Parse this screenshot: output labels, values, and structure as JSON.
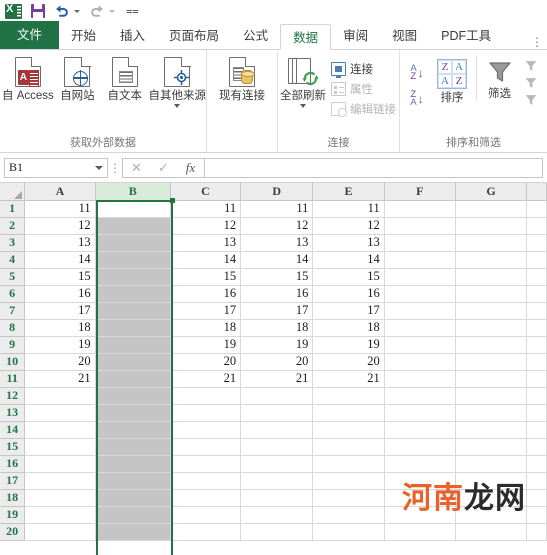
{
  "app": {
    "name": "Excel",
    "active_cell": "B1",
    "formula_value": ""
  },
  "quick_access": {
    "items": [
      {
        "name": "excel-logo",
        "label": "X"
      },
      {
        "name": "save",
        "label": "保存"
      },
      {
        "name": "undo",
        "label": "撤消"
      },
      {
        "name": "redo",
        "label": "恢复"
      },
      {
        "name": "customize",
        "label": "自定义快速访问工具栏"
      }
    ]
  },
  "tabs": {
    "file": "文件",
    "items": [
      {
        "label": "开始",
        "active": false
      },
      {
        "label": "插入",
        "active": false
      },
      {
        "label": "页面布局",
        "active": false
      },
      {
        "label": "公式",
        "active": false
      },
      {
        "label": "数据",
        "active": true
      },
      {
        "label": "审阅",
        "active": false
      },
      {
        "label": "视图",
        "active": false
      },
      {
        "label": "PDF工具",
        "active": false
      }
    ],
    "more": "⋮"
  },
  "ribbon": {
    "groups": [
      {
        "label": "获取外部数据",
        "buttons": [
          {
            "label": "自 Access",
            "icon": "access-doc-icon",
            "dropdown": false
          },
          {
            "label": "自网站",
            "icon": "web-doc-icon",
            "dropdown": false
          },
          {
            "label": "自文本",
            "icon": "text-doc-icon",
            "dropdown": false
          },
          {
            "label": "自其他来源",
            "icon": "other-sources-doc-icon",
            "dropdown": true
          }
        ]
      },
      {
        "label": "",
        "buttons": [
          {
            "label": "现有连接",
            "icon": "existing-connections-icon",
            "dropdown": false
          }
        ]
      },
      {
        "label": "连接",
        "buttons": [
          {
            "label": "全部刷新",
            "icon": "refresh-all-icon",
            "dropdown": true
          }
        ],
        "small_buttons": [
          {
            "label": "连接",
            "icon": "connections-icon",
            "disabled": false
          },
          {
            "label": "属性",
            "icon": "properties-icon",
            "disabled": true
          },
          {
            "label": "编辑链接",
            "icon": "edit-links-icon",
            "disabled": true
          }
        ]
      },
      {
        "label": "排序和筛选",
        "small_buttons": [
          {
            "label": "升序排序",
            "icon": "sort-az-icon",
            "disabled": false
          },
          {
            "label": "降序排序",
            "icon": "sort-za-icon",
            "disabled": false
          }
        ],
        "buttons": [
          {
            "label": "排序",
            "icon": "sort-icon",
            "dropdown": false
          },
          {
            "label": "筛选",
            "icon": "filter-funnel-icon",
            "dropdown": false
          }
        ]
      }
    ]
  },
  "formula_bar": {
    "name_box": "B1",
    "cancel": "✕",
    "confirm": "✓",
    "function": "fx",
    "value": ""
  },
  "sheet": {
    "columns": [
      "A",
      "B",
      "C",
      "D",
      "E",
      "F",
      "G"
    ],
    "selected_column": "B",
    "rows": [
      1,
      2,
      3,
      4,
      5,
      6,
      7,
      8,
      9,
      10,
      11,
      12,
      13,
      14,
      15,
      16,
      17,
      18,
      19,
      20
    ],
    "cells": {
      "A": [
        "11",
        "12",
        "13",
        "14",
        "15",
        "16",
        "17",
        "18",
        "19",
        "20",
        "21",
        "",
        "",
        "",
        "",
        "",
        "",
        "",
        "",
        ""
      ],
      "B": [
        "",
        "",
        "",
        "",
        "",
        "",
        "",
        "",
        "",
        "",
        "",
        "",
        "",
        "",
        "",
        "",
        "",
        "",
        "",
        ""
      ],
      "C": [
        "11",
        "12",
        "13",
        "14",
        "15",
        "16",
        "17",
        "18",
        "19",
        "20",
        "21",
        "",
        "",
        "",
        "",
        "",
        "",
        "",
        "",
        ""
      ],
      "D": [
        "11",
        "12",
        "13",
        "14",
        "15",
        "16",
        "17",
        "18",
        "19",
        "20",
        "21",
        "",
        "",
        "",
        "",
        "",
        "",
        "",
        "",
        ""
      ],
      "E": [
        "11",
        "12",
        "13",
        "14",
        "15",
        "16",
        "17",
        "18",
        "19",
        "20",
        "21",
        "",
        "",
        "",
        "",
        "",
        "",
        "",
        "",
        ""
      ],
      "F": [
        "",
        "",
        "",
        "",
        "",
        "",
        "",
        "",
        "",
        "",
        "",
        "",
        "",
        "",
        "",
        "",
        "",
        "",
        "",
        ""
      ],
      "G": [
        "",
        "",
        "",
        "",
        "",
        "",
        "",
        "",
        "",
        "",
        "",
        "",
        "",
        "",
        "",
        "",
        "",
        "",
        "",
        ""
      ]
    }
  },
  "watermark": {
    "part1": "河南",
    "part2": "龙网",
    "color1": "#e8622a",
    "color2": "#2b2b2b"
  },
  "colors": {
    "brand_green": "#217346",
    "selection_fill": "#c5c5c5",
    "header_gray": "#ececec"
  }
}
